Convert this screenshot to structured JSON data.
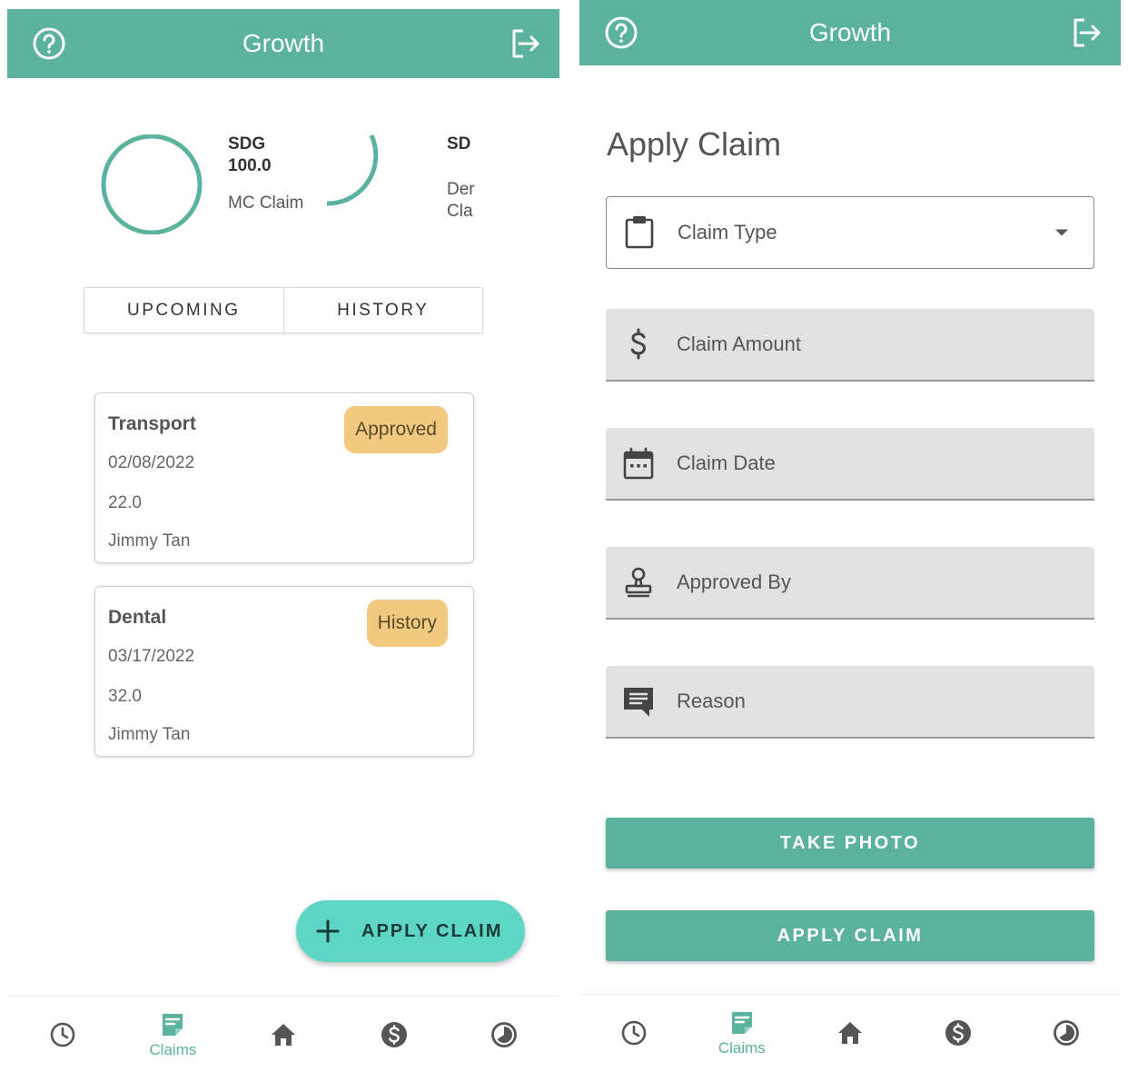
{
  "app": {
    "title": "Growth"
  },
  "left": {
    "stats": [
      {
        "code": "SDG",
        "value": "100.0",
        "name": "MC Claim"
      },
      {
        "code": "SD",
        "name_line1": "Der",
        "name_line2": "Cla"
      }
    ],
    "tabs": [
      "UPCOMING",
      "HISTORY"
    ],
    "claims": [
      {
        "type": "Transport",
        "date": "02/08/2022",
        "amount": "22.0",
        "person": "Jimmy Tan",
        "status": "Approved"
      },
      {
        "type": "Dental",
        "date": "03/17/2022",
        "amount": "32.0",
        "person": "Jimmy Tan",
        "status": "History"
      }
    ],
    "fab_label": "APPLY CLAIM"
  },
  "right": {
    "page_title": "Apply Claim",
    "fields": {
      "claim_type": "Claim Type",
      "claim_amount": "Claim Amount",
      "claim_date": "Claim Date",
      "approved_by": "Approved By",
      "reason": "Reason"
    },
    "take_photo_label": "TAKE PHOTO",
    "apply_claim_label": "APPLY CLAIM"
  },
  "nav": {
    "items": [
      "clock-icon",
      "claims-icon",
      "home-icon",
      "dollar-icon",
      "pie-chart-icon"
    ],
    "active_label": "Claims"
  },
  "colors": {
    "primary": "#5bb29e",
    "fab": "#5dd6c5",
    "badge": "#f2c981",
    "field_fill": "#e2e2e2"
  }
}
